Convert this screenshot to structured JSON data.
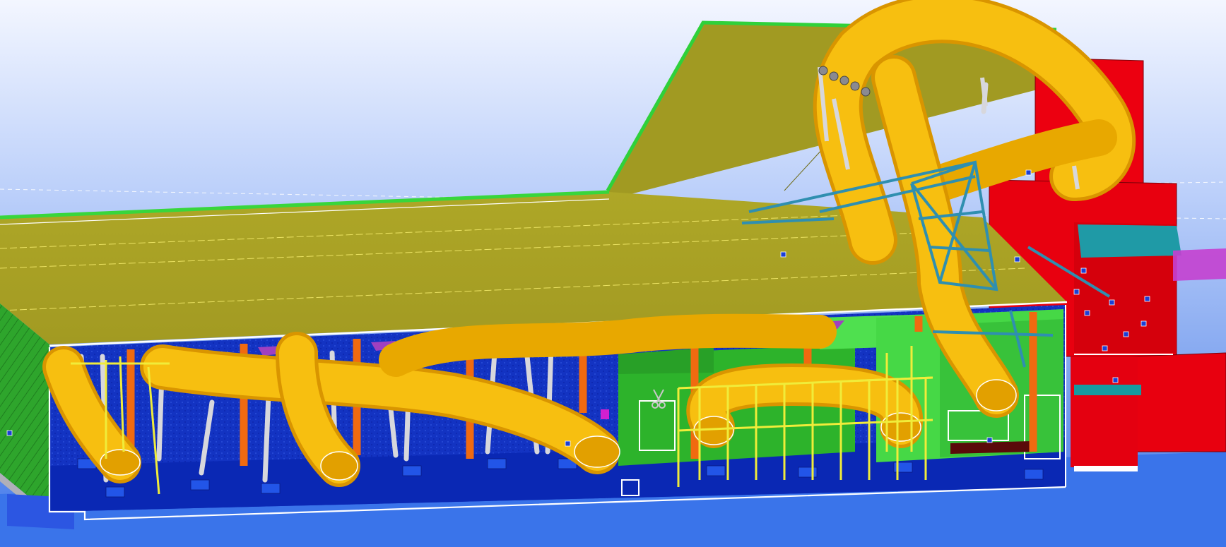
{
  "viewport": {
    "view_mode": "3D model view",
    "background_gradient": [
      "#f3f6ff",
      "#8fb1f3",
      "#3f76ea"
    ]
  },
  "colors": {
    "roof": "#a69e26",
    "roof_edge": "#2fd13a",
    "wall_green": "#31b22e",
    "floor_blue": "#1435c8",
    "pit_blue": "#0a28b4",
    "slide_yellow": "#f5b800",
    "column_orange": "#f06a10",
    "steel_white": "#d7d7dc",
    "rail_yellow": "#f0ec3a",
    "tower_red": "#ec0010",
    "truss_teal": "#2f8fb0",
    "beam_purple": "#a040c0",
    "outline_white": "#ffffff"
  },
  "model": {
    "objects": [
      {
        "name": "roof-slab",
        "kind": "slab"
      },
      {
        "name": "upper-roof-block",
        "kind": "slab"
      },
      {
        "name": "side-wall-left",
        "kind": "wall"
      },
      {
        "name": "pool-floor",
        "kind": "slab"
      },
      {
        "name": "inner-green-room",
        "kind": "wall"
      },
      {
        "name": "slide-tower",
        "kind": "tower"
      },
      {
        "name": "access-truss",
        "kind": "truss"
      },
      {
        "name": "water-slide-tubes",
        "kind": "slide"
      },
      {
        "name": "support-columns",
        "kind": "column"
      },
      {
        "name": "handrails",
        "kind": "railing"
      }
    ]
  }
}
